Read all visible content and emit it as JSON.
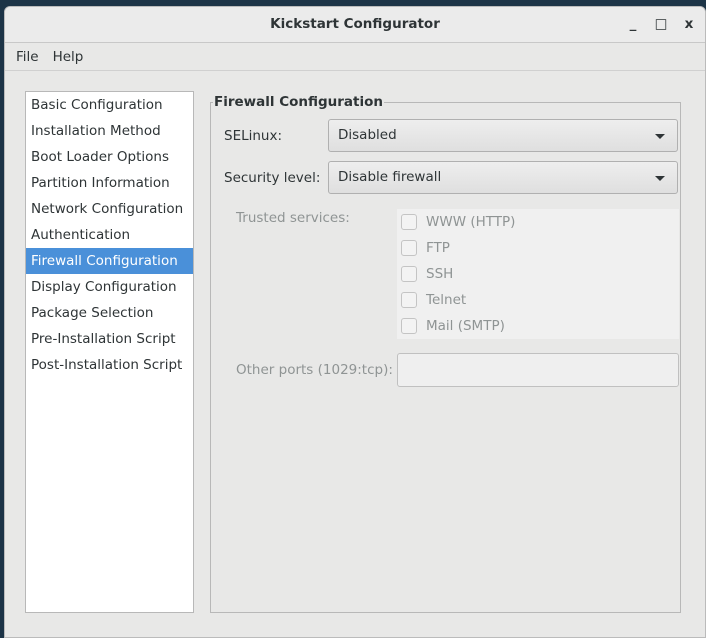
{
  "window": {
    "title": "Kickstart Configurator",
    "minimize": "_",
    "maximize": "□",
    "close": "x"
  },
  "menu": [
    "File",
    "Help"
  ],
  "sidebar": {
    "items": [
      "Basic Configuration",
      "Installation Method",
      "Boot Loader Options",
      "Partition Information",
      "Network Configuration",
      "Authentication",
      "Firewall Configuration",
      "Display Configuration",
      "Package Selection",
      "Pre-Installation Script",
      "Post-Installation Script"
    ],
    "selected": "Firewall Configuration",
    "accent": "#4a90d9"
  },
  "firewall": {
    "title": "Firewall Configuration",
    "selinux_label": "SELinux:",
    "selinux_value": "Disabled",
    "security_label": "Security level:",
    "security_value": "Disable firewall",
    "trusted_label": "Trusted services:",
    "services": [
      {
        "label": "WWW (HTTP)",
        "checked": false
      },
      {
        "label": "FTP",
        "checked": false
      },
      {
        "label": "SSH",
        "checked": false
      },
      {
        "label": "Telnet",
        "checked": false
      },
      {
        "label": "Mail (SMTP)",
        "checked": false
      }
    ],
    "other_ports_label": "Other ports (1029:tcp):",
    "other_ports_value": ""
  }
}
